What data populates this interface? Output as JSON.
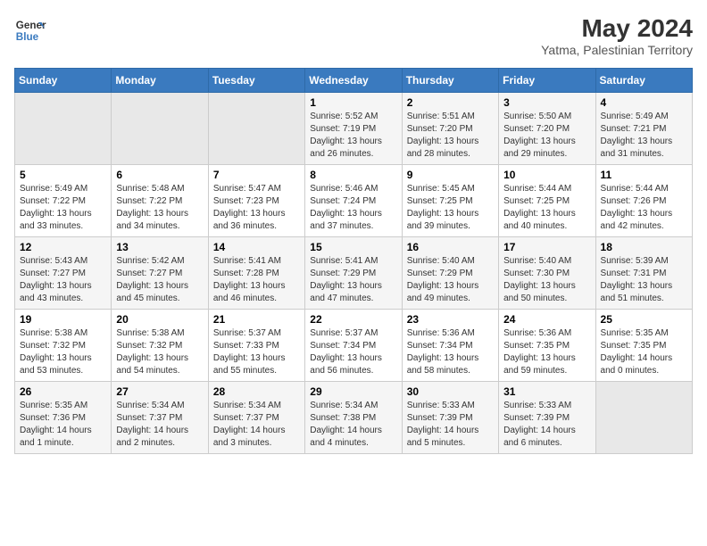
{
  "logo": {
    "line1": "General",
    "line2": "Blue"
  },
  "title": "May 2024",
  "subtitle": "Yatma, Palestinian Territory",
  "days_header": [
    "Sunday",
    "Monday",
    "Tuesday",
    "Wednesday",
    "Thursday",
    "Friday",
    "Saturday"
  ],
  "weeks": [
    [
      {
        "num": "",
        "info": ""
      },
      {
        "num": "",
        "info": ""
      },
      {
        "num": "",
        "info": ""
      },
      {
        "num": "1",
        "info": "Sunrise: 5:52 AM\nSunset: 7:19 PM\nDaylight: 13 hours and 26 minutes."
      },
      {
        "num": "2",
        "info": "Sunrise: 5:51 AM\nSunset: 7:20 PM\nDaylight: 13 hours and 28 minutes."
      },
      {
        "num": "3",
        "info": "Sunrise: 5:50 AM\nSunset: 7:20 PM\nDaylight: 13 hours and 29 minutes."
      },
      {
        "num": "4",
        "info": "Sunrise: 5:49 AM\nSunset: 7:21 PM\nDaylight: 13 hours and 31 minutes."
      }
    ],
    [
      {
        "num": "5",
        "info": "Sunrise: 5:49 AM\nSunset: 7:22 PM\nDaylight: 13 hours and 33 minutes."
      },
      {
        "num": "6",
        "info": "Sunrise: 5:48 AM\nSunset: 7:22 PM\nDaylight: 13 hours and 34 minutes."
      },
      {
        "num": "7",
        "info": "Sunrise: 5:47 AM\nSunset: 7:23 PM\nDaylight: 13 hours and 36 minutes."
      },
      {
        "num": "8",
        "info": "Sunrise: 5:46 AM\nSunset: 7:24 PM\nDaylight: 13 hours and 37 minutes."
      },
      {
        "num": "9",
        "info": "Sunrise: 5:45 AM\nSunset: 7:25 PM\nDaylight: 13 hours and 39 minutes."
      },
      {
        "num": "10",
        "info": "Sunrise: 5:44 AM\nSunset: 7:25 PM\nDaylight: 13 hours and 40 minutes."
      },
      {
        "num": "11",
        "info": "Sunrise: 5:44 AM\nSunset: 7:26 PM\nDaylight: 13 hours and 42 minutes."
      }
    ],
    [
      {
        "num": "12",
        "info": "Sunrise: 5:43 AM\nSunset: 7:27 PM\nDaylight: 13 hours and 43 minutes."
      },
      {
        "num": "13",
        "info": "Sunrise: 5:42 AM\nSunset: 7:27 PM\nDaylight: 13 hours and 45 minutes."
      },
      {
        "num": "14",
        "info": "Sunrise: 5:41 AM\nSunset: 7:28 PM\nDaylight: 13 hours and 46 minutes."
      },
      {
        "num": "15",
        "info": "Sunrise: 5:41 AM\nSunset: 7:29 PM\nDaylight: 13 hours and 47 minutes."
      },
      {
        "num": "16",
        "info": "Sunrise: 5:40 AM\nSunset: 7:29 PM\nDaylight: 13 hours and 49 minutes."
      },
      {
        "num": "17",
        "info": "Sunrise: 5:40 AM\nSunset: 7:30 PM\nDaylight: 13 hours and 50 minutes."
      },
      {
        "num": "18",
        "info": "Sunrise: 5:39 AM\nSunset: 7:31 PM\nDaylight: 13 hours and 51 minutes."
      }
    ],
    [
      {
        "num": "19",
        "info": "Sunrise: 5:38 AM\nSunset: 7:32 PM\nDaylight: 13 hours and 53 minutes."
      },
      {
        "num": "20",
        "info": "Sunrise: 5:38 AM\nSunset: 7:32 PM\nDaylight: 13 hours and 54 minutes."
      },
      {
        "num": "21",
        "info": "Sunrise: 5:37 AM\nSunset: 7:33 PM\nDaylight: 13 hours and 55 minutes."
      },
      {
        "num": "22",
        "info": "Sunrise: 5:37 AM\nSunset: 7:34 PM\nDaylight: 13 hours and 56 minutes."
      },
      {
        "num": "23",
        "info": "Sunrise: 5:36 AM\nSunset: 7:34 PM\nDaylight: 13 hours and 58 minutes."
      },
      {
        "num": "24",
        "info": "Sunrise: 5:36 AM\nSunset: 7:35 PM\nDaylight: 13 hours and 59 minutes."
      },
      {
        "num": "25",
        "info": "Sunrise: 5:35 AM\nSunset: 7:35 PM\nDaylight: 14 hours and 0 minutes."
      }
    ],
    [
      {
        "num": "26",
        "info": "Sunrise: 5:35 AM\nSunset: 7:36 PM\nDaylight: 14 hours and 1 minute."
      },
      {
        "num": "27",
        "info": "Sunrise: 5:34 AM\nSunset: 7:37 PM\nDaylight: 14 hours and 2 minutes."
      },
      {
        "num": "28",
        "info": "Sunrise: 5:34 AM\nSunset: 7:37 PM\nDaylight: 14 hours and 3 minutes."
      },
      {
        "num": "29",
        "info": "Sunrise: 5:34 AM\nSunset: 7:38 PM\nDaylight: 14 hours and 4 minutes."
      },
      {
        "num": "30",
        "info": "Sunrise: 5:33 AM\nSunset: 7:39 PM\nDaylight: 14 hours and 5 minutes."
      },
      {
        "num": "31",
        "info": "Sunrise: 5:33 AM\nSunset: 7:39 PM\nDaylight: 14 hours and 6 minutes."
      },
      {
        "num": "",
        "info": ""
      }
    ]
  ]
}
